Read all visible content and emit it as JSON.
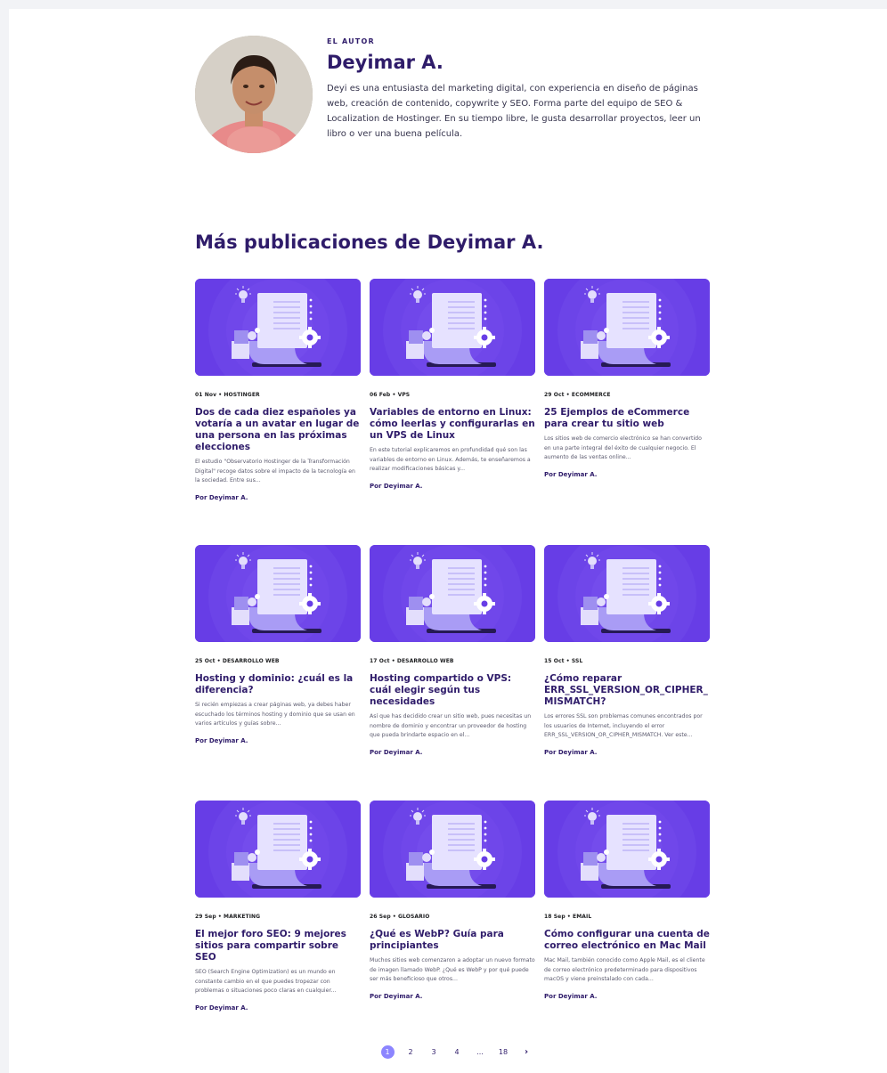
{
  "author": {
    "eyebrow": "EL AUTOR",
    "name": "Deyimar A.",
    "bio": "Deyi es una entusiasta del marketing digital, con experiencia en diseño de páginas web, creación de contenido, copywrite y SEO. Forma parte del equipo de SEO & Localization de Hostinger. En su tiempo libre, le gusta desarrollar proyectos, leer un libro o ver una buena película."
  },
  "section_title": "Más publicaciones de Deyimar A.",
  "posts": [
    {
      "meta": "01 Nov • HOSTINGER",
      "title": "Dos de cada diez españoles ya votaría a un avatar en lugar de una persona en las próximas elecciones",
      "excerpt": "El estudio \"Observatorio Hostinger de la Transformación Digital\" recoge datos sobre el impacto de la tecnología en la sociedad. Entre sus...",
      "author": "Por Deyimar A."
    },
    {
      "meta": "06 Feb • VPS",
      "title": "Variables de entorno en Linux: cómo leerlas y configurarlas en un VPS de Linux",
      "excerpt": "En este tutorial explicaremos en profundidad qué son las variables de entorno en Linux. Además, te enseñaremos a realizar modificaciones básicas y...",
      "author": "Por Deyimar A."
    },
    {
      "meta": "29 Oct • ECOMMERCE",
      "title": "25 Ejemplos de eCommerce para crear tu sitio web",
      "excerpt": "Los sitios web de comercio electrónico se han convertido en una parte integral del éxito de cualquier negocio.  El aumento de las ventas online...",
      "author": "Por Deyimar A."
    },
    {
      "meta": "25 Oct • DESARROLLO WEB",
      "title": "Hosting y dominio: ¿cuál es la diferencia?",
      "excerpt": "Si recién empiezas a crear páginas web, ya debes haber escuchado los términos hosting y dominio que se usan en varios artículos y guías sobre...",
      "author": "Por Deyimar A."
    },
    {
      "meta": "17 Oct • DESARROLLO WEB",
      "title": "Hosting compartido o VPS: cuál elegir según tus necesidades",
      "excerpt": "Así que has decidido crear un sitio web, pues necesitas un nombre de dominio y encontrar un proveedor de hosting que pueda brindarte espacio en el...",
      "author": "Por Deyimar A."
    },
    {
      "meta": "15 Oct • SSL",
      "title": "¿Cómo reparar ERR_SSL_VERSION_OR_CIPHER_ MISMATCH?",
      "excerpt": "Los errores SSL son problemas comunes encontrados por los usuarios de Internet, incluyendo el error ERR_SSL_VERSION_OR_CIPHER_MISMATCH. Ver este...",
      "author": "Por Deyimar A."
    },
    {
      "meta": "29 Sep • MARKETING",
      "title": "El mejor foro SEO: 9 mejores sitios para compartir sobre SEO",
      "excerpt": "SEO (Search Engine Optimization) es un mundo en constante cambio en el que puedes tropezar con problemas o situaciones poco claras en cualquier...",
      "author": "Por Deyimar A."
    },
    {
      "meta": "26 Sep • GLOSARIO",
      "title": "¿Qué es WebP? Guía para principiantes",
      "excerpt": "Muchos sitios web comenzaron a adoptar un nuevo formato de imagen llamado WebP. ¿Qué es WebP y por qué puede ser más beneficioso que otros...",
      "author": "Por Deyimar A."
    },
    {
      "meta": "18 Sep • EMAIL",
      "title": "Cómo configurar una cuenta de correo electrónico en Mac Mail",
      "excerpt": "Mac Mail, también conocido como Apple Mail, es el cliente de correo electrónico predeterminado para dispositivos macOS y viene preinstalado con cada...",
      "author": "Por Deyimar A."
    }
  ],
  "pagination": {
    "pages": [
      "1",
      "2",
      "3",
      "4",
      "...",
      "18"
    ],
    "current": "1",
    "next": "›"
  },
  "colors": {
    "brand_purple": "#673de6",
    "title_navy": "#2f1c6a",
    "active_page": "#8c85ff"
  },
  "icons": {
    "post_thumbnail": "document-lightbulb-gear-puzzle-illustration",
    "next_page": "chevron-right-icon"
  }
}
